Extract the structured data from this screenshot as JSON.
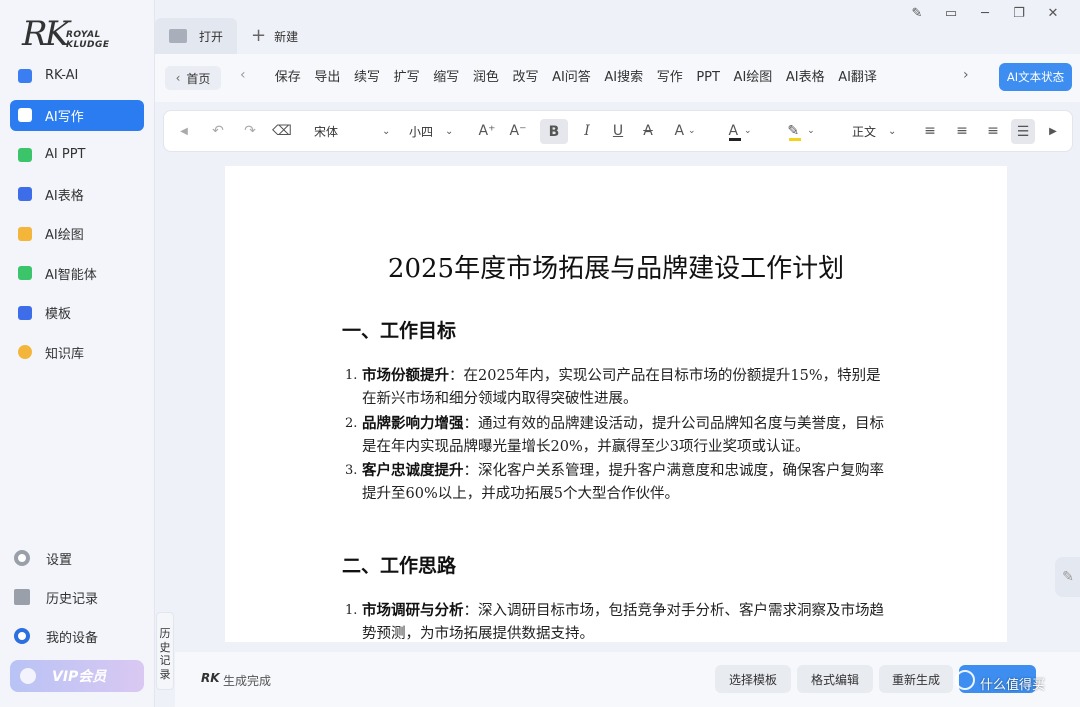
{
  "app": {
    "logo_mark": "RK",
    "logo_line1": "ROYAL",
    "logo_line2": "KLUDGE"
  },
  "sidebar": {
    "items": [
      {
        "label": "RK-AI",
        "icon": "rk-ai-icon"
      },
      {
        "label": "AI写作",
        "icon": "ai-writing-icon",
        "active": true
      },
      {
        "label": "AI PPT",
        "icon": "ai-ppt-icon"
      },
      {
        "label": "AI表格",
        "icon": "ai-table-icon"
      },
      {
        "label": "AI绘图",
        "icon": "ai-drawing-icon"
      },
      {
        "label": "AI智能体",
        "icon": "ai-agent-icon"
      },
      {
        "label": "模板",
        "icon": "template-icon"
      },
      {
        "label": "知识库",
        "icon": "knowledge-base-icon"
      }
    ],
    "bottom": {
      "settings": "设置",
      "history": "历史记录",
      "devices": "我的设备",
      "vip": "VIP会员"
    }
  },
  "tabs": {
    "open": "打开",
    "new": "新建"
  },
  "toolbar": {
    "home": "首页",
    "tools": [
      "保存",
      "导出",
      "续写",
      "扩写",
      "缩写",
      "润色",
      "改写",
      "AI问答",
      "AI搜索",
      "写作",
      "PPT",
      "AI绘图",
      "AI表格",
      "AI翻译"
    ],
    "status_button": "AI文本状态"
  },
  "format": {
    "font": "宋体",
    "size": "小四",
    "style": "正文",
    "font_color": "#222222",
    "highlight_color": "#f2d21b"
  },
  "document": {
    "title": "2025年度市场拓展与品牌建设工作计划",
    "section1": {
      "heading": "一、工作目标",
      "items": [
        {
          "num": "1.",
          "lead": "市场份额提升",
          "text": "：在2025年内，实现公司产品在目标市场的份额提升15%，特别是在新兴市场和细分领域内取得突破性进展。"
        },
        {
          "num": "2.",
          "lead": "品牌影响力增强",
          "text": "：通过有效的品牌建设活动，提升公司品牌知名度与美誉度，目标是在年内实现品牌曝光量增长20%，并赢得至少3项行业奖项或认证。"
        },
        {
          "num": "3.",
          "lead": "客户忠诚度提升",
          "text": "：深化客户关系管理，提升客户满意度和忠诚度，确保客户复购率提升至60%以上，并成功拓展5个大型合作伙伴。"
        }
      ]
    },
    "section2": {
      "heading": "二、工作思路",
      "items": [
        {
          "num": "1.",
          "lead": "市场调研与分析",
          "text": "：深入调研目标市场，包括竞争对手分析、客户需求洞察及市场趋势预测，为市场拓展提供数据支持。"
        }
      ]
    }
  },
  "side_tab": "历史记录",
  "bottom_bar": {
    "status": "生成完成",
    "select_template": "选择模板",
    "format_edit": "格式编辑",
    "regenerate": "重新生成",
    "watermark": "什么值得买"
  }
}
